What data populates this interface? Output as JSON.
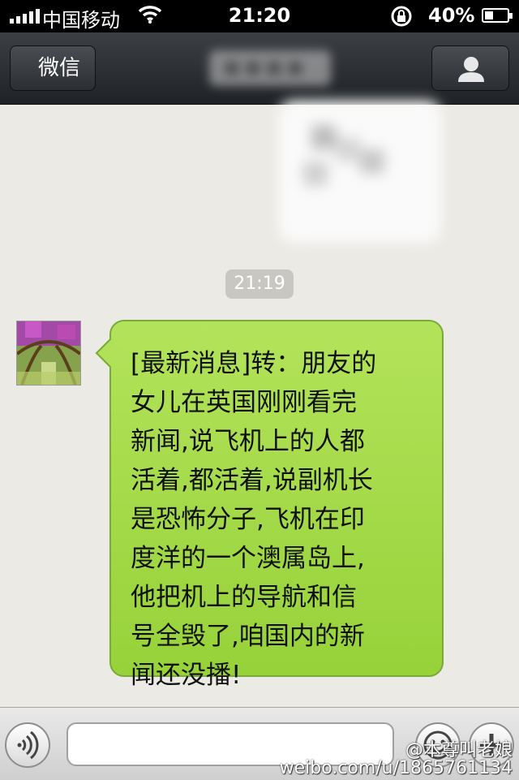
{
  "status_bar": {
    "carrier": "中国移动",
    "time": "21:20",
    "battery_percent": "40%",
    "battery_level": 0.4,
    "icons": [
      "signal-icon",
      "wifi-icon",
      "rotation-lock-icon",
      "battery-icon"
    ]
  },
  "nav": {
    "back_label": "微信",
    "title": "",
    "profile_icon": "person-icon"
  },
  "chat": {
    "timestamp": "21:19",
    "messages": [
      {
        "sender": "other",
        "text": "[最新消息]转：朋友的\n女儿在英国刚刚看完\n新闻,说飞机上的人都\n活着,都活着,说副机长\n是恐怖分子,飞机在印\n度洋的一个澳属岛上,\n他把机上的导航和信\n号全毁了,咱国内的新\n闻还没播!"
      }
    ]
  },
  "input_bar": {
    "text_value": "",
    "icons": [
      "voice-icon",
      "emoji-icon",
      "plus-icon"
    ]
  },
  "watermark": {
    "line1": "@本尊叫老娘",
    "line2": "weibo.com/u/1865761134"
  },
  "colors": {
    "bubble_green": "#a6dc4a",
    "nav_dark": "#2b2e32",
    "chat_bg": "#eceae5"
  }
}
